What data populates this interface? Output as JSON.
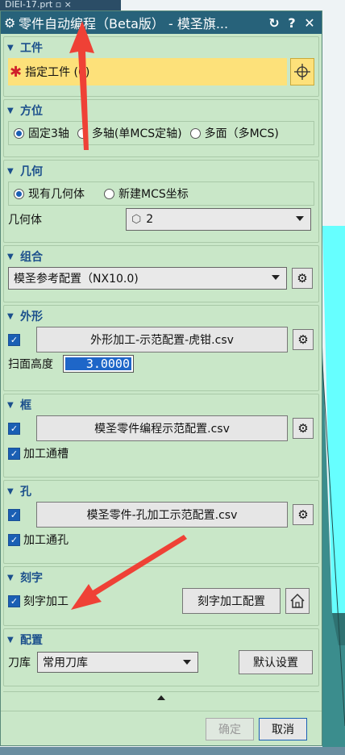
{
  "file_tab": "DIEI-17.prt",
  "title": "零件自动编程（Beta版） - 模圣旗...",
  "title_buttons": [
    "↻",
    "?",
    "✕"
  ],
  "sections": {
    "workpiece": {
      "label": "工件",
      "specify": "指定工件 (0)"
    },
    "orientation": {
      "label": "方位",
      "options": [
        "固定3轴",
        "多轴(单MCS定轴)",
        "多面（多MCS)"
      ],
      "selected": 0
    },
    "geometry": {
      "label": "几何",
      "options": [
        "现有几何体",
        "新建MCS坐标"
      ],
      "selected": 0,
      "geom_label": "几何体",
      "geom_value": "2"
    },
    "group": {
      "label": "组合",
      "value": "模圣参考配置（NX10.0)"
    },
    "profile": {
      "label": "外形",
      "file": "外形加工-示范配置-虎钳.csv",
      "sweep_label": "扫面高度",
      "sweep_value": "3.0000"
    },
    "frame": {
      "label": "框",
      "file": "模圣零件编程示范配置.csv",
      "check_label": "加工通槽"
    },
    "hole": {
      "label": "孔",
      "file": "模圣零件-孔加工示范配置.csv",
      "check_label": "加工通孔"
    },
    "engrave": {
      "label": "刻字",
      "check_label": "刻字加工",
      "config_button": "刻字加工配置"
    },
    "config": {
      "label": "配置",
      "tool_label": "刀库",
      "tool_value": "常用刀库",
      "default_button": "默认设置"
    }
  },
  "footer": {
    "ok": "确定",
    "cancel": "取消"
  },
  "colors": {
    "title_bar": "#27627a",
    "panel": "#c9e7c8",
    "section_label": "#1b4f8c",
    "highlight": "#fde17a",
    "annotation_arrow": "#ef4136"
  }
}
